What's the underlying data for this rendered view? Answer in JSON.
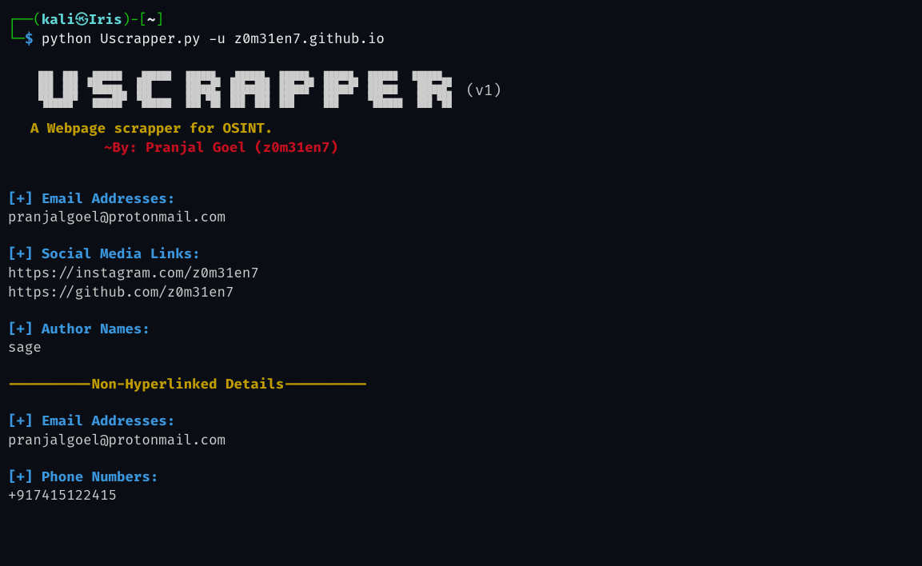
{
  "prompt": {
    "line1_open": "┌──(",
    "user": "kali",
    "skull": "㉿",
    "host": "Iris",
    "line1_mid": ")-[",
    "cwd": "~",
    "line1_close": "]",
    "line2_prefix": "└─",
    "dollar": "$",
    "command": " python Uscrapper.py -u z0m31en7.github.io"
  },
  "banner": {
    "ascii": "███  ███   ██████    ██████   ██████    ██████   ██████   ██████   ██████   ██████\n███  ███  ███       ███       ███  ██  ███  ███  ███  ██  ███  ██  ███       ███  ██\n███  ███   ██████   ███       ██████   ████████  ██████   ██████   ██████    ██████\n███  ███       ███  ███       ███ ███  ███  ███  ███      ███      ███       ███ ███\n ██████    ██████    ██████   ███  ██  ███  ███  ███      ███       ██████   ███  ██",
    "version": "(v1)",
    "tagline": "A Webpage scrapper for OSINT.",
    "author": "~By: Pranjal Goel (z0m31en7)"
  },
  "sections": [
    {
      "header": "[+] Email Addresses:",
      "values": [
        "pranjalgoel@protonmail.com"
      ]
    },
    {
      "header": "[+] Social Media Links:",
      "values": [
        "https://instagram.com/z0m31en7",
        "https://github.com/z0m31en7"
      ]
    },
    {
      "header": "[+] Author Names:",
      "values": [
        "sage"
      ]
    }
  ],
  "divider": "----------Non-Hyperlinked Details----------",
  "sections2": [
    {
      "header": "[+] Email Addresses:",
      "values": [
        "pranjalgoel@protonmail.com"
      ]
    },
    {
      "header": "[+] Phone Numbers:",
      "values": [
        "+917415122415"
      ]
    }
  ]
}
